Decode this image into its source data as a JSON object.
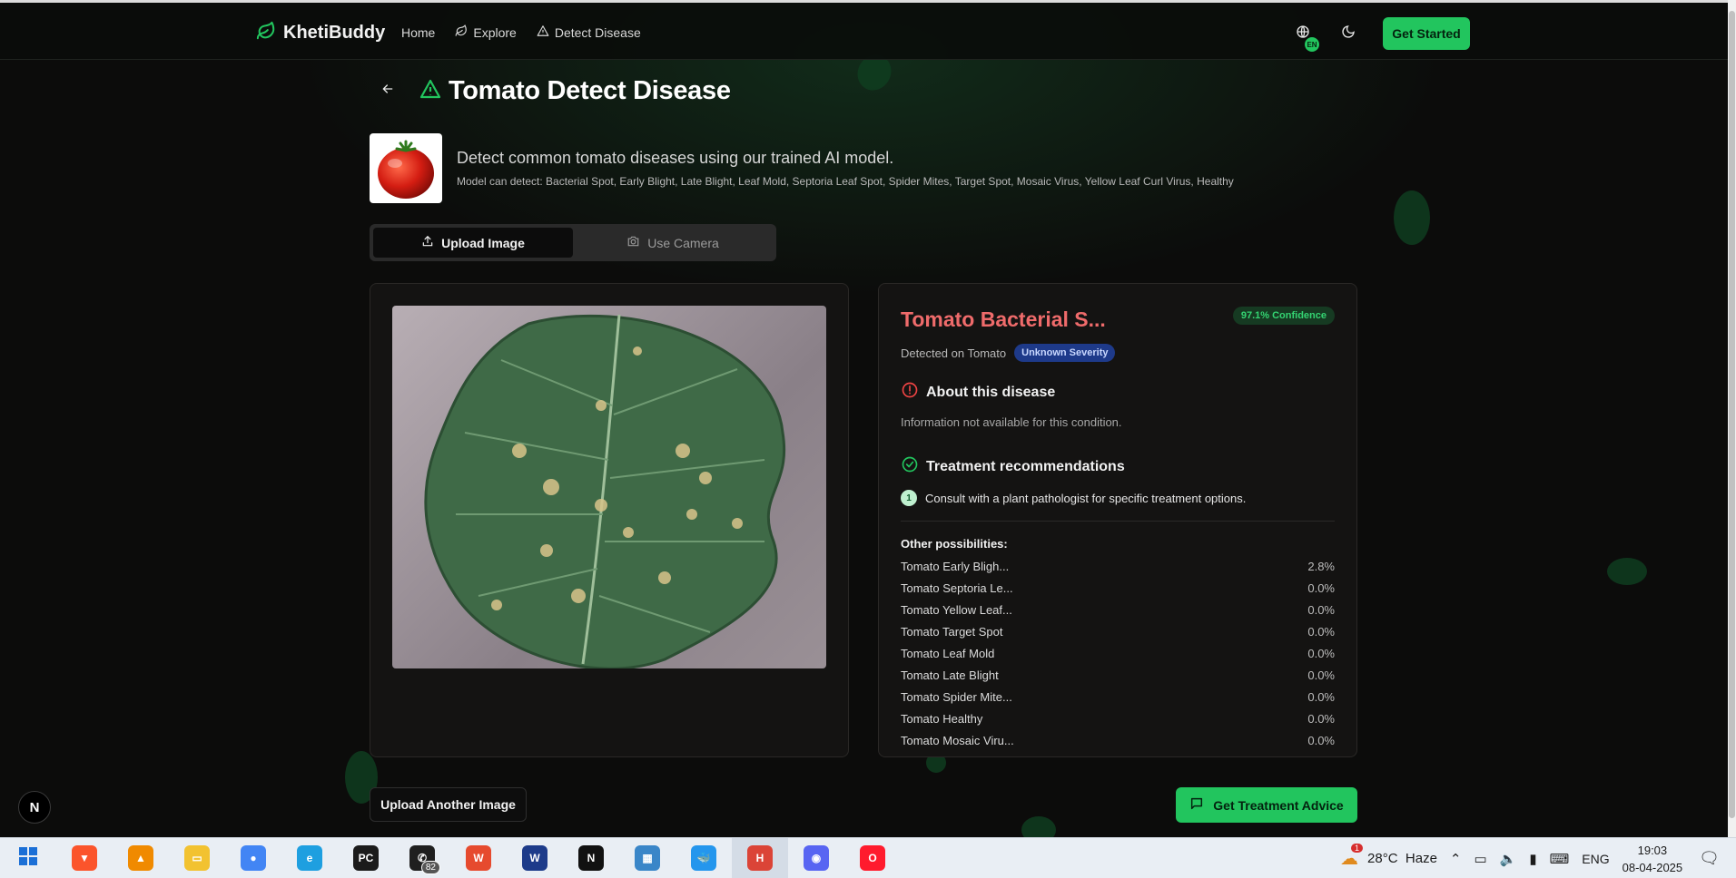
{
  "header": {
    "brand": "KhetiBuddy",
    "nav": [
      {
        "label": "Home"
      },
      {
        "label": "Explore"
      },
      {
        "label": "Detect Disease"
      }
    ],
    "language_badge": "EN",
    "cta_label": "Get Started"
  },
  "page": {
    "title": "Tomato Detect Disease",
    "subtitle": "Detect common tomato diseases using our trained AI model.",
    "model_detects": "Model can detect: Bacterial Spot, Early Blight, Late Blight, Leaf Mold, Septoria Leaf Spot, Spider Mites, Target Spot, Mosaic Virus, Yellow Leaf Curl Virus, Healthy"
  },
  "tabs": [
    {
      "label": "Upload Image",
      "active": true
    },
    {
      "label": "Use Camera",
      "active": false
    }
  ],
  "result": {
    "disease_name": "Tomato Bacterial S...",
    "confidence": "97.1% Confidence",
    "detected_on": "Detected on Tomato",
    "severity": "Unknown Severity",
    "about_heading": "About this disease",
    "about_text": "Information not available for this condition.",
    "treatment_heading": "Treatment recommendations",
    "treatments": [
      {
        "num": "1",
        "text": "Consult with a plant pathologist for specific treatment options."
      }
    ],
    "other_heading": "Other possibilities:",
    "possibilities": [
      {
        "name": "Tomato Early Bligh...",
        "value": "2.8%"
      },
      {
        "name": "Tomato Septoria Le...",
        "value": "0.0%"
      },
      {
        "name": "Tomato Yellow Leaf...",
        "value": "0.0%"
      },
      {
        "name": "Tomato Target Spot",
        "value": "0.0%"
      },
      {
        "name": "Tomato Leaf Mold",
        "value": "0.0%"
      },
      {
        "name": "Tomato Late Blight",
        "value": "0.0%"
      },
      {
        "name": "Tomato Spider Mite...",
        "value": "0.0%"
      },
      {
        "name": "Tomato Healthy",
        "value": "0.0%"
      },
      {
        "name": "Tomato Mosaic Viru...",
        "value": "0.0%"
      }
    ]
  },
  "actions": {
    "upload_another": "Upload Another Image",
    "treatment_advice": "Get Treatment Advice"
  },
  "dev_badge": "N",
  "taskbar": {
    "apps": [
      {
        "name": "brave",
        "color": "#fb542b",
        "glyph": "▼"
      },
      {
        "name": "vlc",
        "color": "#f08a00",
        "glyph": "▲"
      },
      {
        "name": "file-explorer",
        "color": "#f2c230",
        "glyph": "▭"
      },
      {
        "name": "chrome",
        "color": "#4285f4",
        "glyph": "●"
      },
      {
        "name": "edge",
        "color": "#1e9fe0",
        "glyph": "e"
      },
      {
        "name": "pycharm",
        "color": "#1b1b1b",
        "glyph": "PC"
      },
      {
        "name": "whatsapp",
        "color": "#1f1f1f",
        "glyph": "✆",
        "badge": "82"
      },
      {
        "name": "wps-office",
        "color": "#e64a2e",
        "glyph": "W"
      },
      {
        "name": "webstorm",
        "color": "#1d3b8a",
        "glyph": "W"
      },
      {
        "name": "notion",
        "color": "#111111",
        "glyph": "N"
      },
      {
        "name": "control-panel",
        "color": "#3a86c8",
        "glyph": "▦"
      },
      {
        "name": "docker",
        "color": "#2496ed",
        "glyph": "🐳"
      },
      {
        "name": "chrome-profile",
        "color": "#db4437",
        "glyph": "H",
        "active": true
      },
      {
        "name": "discord-like",
        "color": "#5865f2",
        "glyph": "◉"
      },
      {
        "name": "opera",
        "color": "#ff1b2d",
        "glyph": "O"
      }
    ],
    "weather": "28°C  Haze",
    "weather_alert": "1",
    "lang": "ENG",
    "time": "19:03",
    "date": "08-04-2025"
  }
}
